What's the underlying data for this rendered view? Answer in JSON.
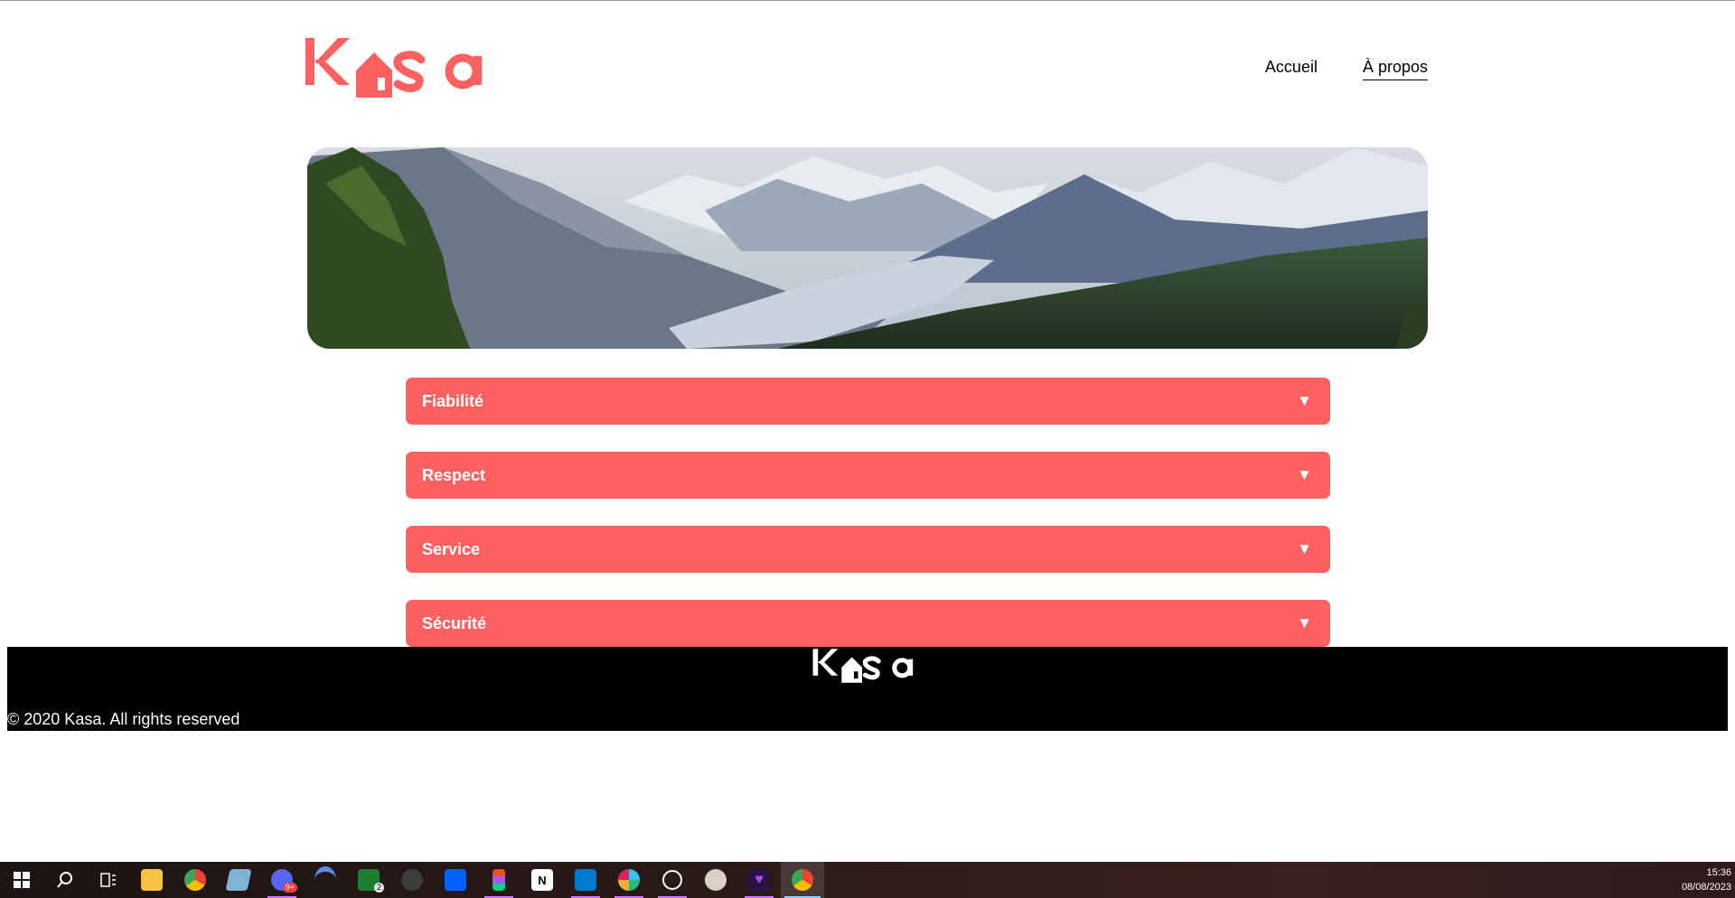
{
  "header": {
    "logo_text": "Kasa",
    "nav": [
      {
        "label": "Accueil"
      },
      {
        "label": "À propos"
      }
    ]
  },
  "collapses": [
    {
      "title": "Fiabilité",
      "chevron": "▼"
    },
    {
      "title": "Respect",
      "chevron": "▼"
    },
    {
      "title": "Service",
      "chevron": "▼"
    },
    {
      "title": "Sécurité",
      "chevron": "▼"
    }
  ],
  "footer": {
    "logo_text": "Kasa",
    "copyright": "© 2020 Kasa. All rights reserved"
  },
  "taskbar": {
    "items": [
      {
        "icon": "windows-start-icon"
      },
      {
        "icon": "search-icon"
      },
      {
        "icon": "task-view-icon"
      },
      {
        "icon": "file-explorer-icon"
      },
      {
        "icon": "chrome-icon"
      },
      {
        "icon": "notes-app-icon"
      },
      {
        "icon": "discord-icon",
        "badge": "9+"
      },
      {
        "icon": "arc-icon"
      },
      {
        "icon": "xbox-icon",
        "badge": "2"
      },
      {
        "icon": "fl-studio-icon"
      },
      {
        "icon": "dropbox-icon"
      },
      {
        "icon": "figma-icon"
      },
      {
        "icon": "notion-icon"
      },
      {
        "icon": "vscode-icon"
      },
      {
        "icon": "slack-icon"
      },
      {
        "icon": "chatgpt-icon"
      },
      {
        "icon": "paint-icon"
      },
      {
        "icon": "heart-app-icon"
      },
      {
        "icon": "chrome-icon"
      }
    ],
    "time": "15:36",
    "date": "08/08/2023"
  },
  "colors": {
    "brand": "#ff6060",
    "footer_bg": "#000000"
  }
}
